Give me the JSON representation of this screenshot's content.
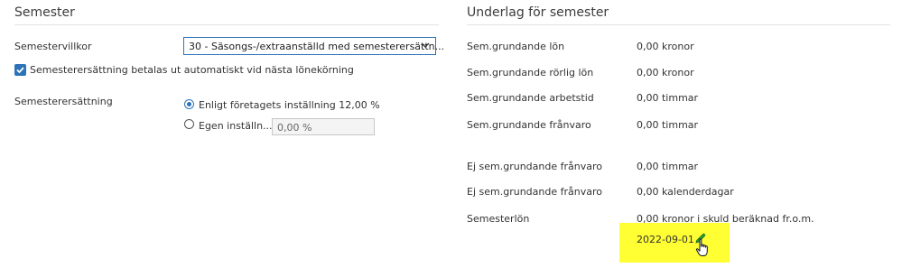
{
  "left": {
    "title": "Semester",
    "semestervillkor_label": "Semestervillkor",
    "semestervillkor_value": "30 - Säsongs-/extraanställd med semesterersättn...",
    "auto_payout_label": "Semesterersättning betalas ut automatiskt vid nästa lönekörning",
    "auto_payout_checked": true,
    "ersattning_label": "Semesterersättning",
    "radio_company_label": "Enligt företagets inställning 12,00 %",
    "radio_custom_label": "Egen inställn...",
    "custom_value": "0,00 %"
  },
  "right": {
    "title": "Underlag för semester",
    "rows": [
      {
        "label": "Sem.grundande lön",
        "value": "0,00 kronor"
      },
      {
        "label": "Sem.grundande rörlig lön",
        "value": "0,00 kronor"
      },
      {
        "label": "Sem.grundande arbetstid",
        "value": "0,00 timmar"
      },
      {
        "label": "Sem.grundande frånvaro",
        "value": "0,00 timmar"
      },
      {
        "label": "Ej sem.grundande frånvaro",
        "value": "0,00 timmar"
      },
      {
        "label": "Ej sem.grundande frånvaro",
        "value": "0,00 kalenderdagar"
      },
      {
        "label": "Semesterlön",
        "value": "0,00 kronor i skuld beräknad fr.o.m."
      }
    ],
    "semesterlon_date": "2022-09-01"
  },
  "icons": {
    "dropdown": "chevron-down-icon",
    "edit": "pencil-icon",
    "cursor": "hand-pointer-icon"
  },
  "colors": {
    "accent": "#2d73b8",
    "highlight": "#ffff33",
    "pencil": "#2e9b2e"
  }
}
